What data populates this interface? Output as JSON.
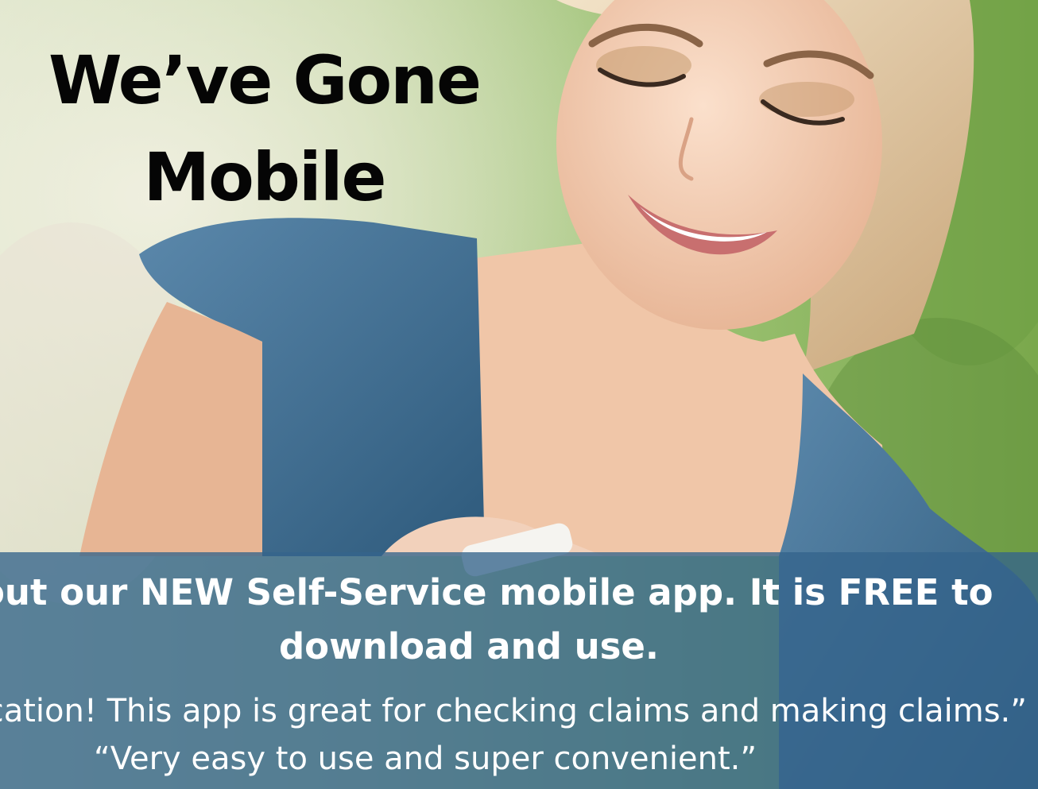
{
  "promo_slide": {
    "headline": [
      "We’ve Gone",
      "Mobile"
    ],
    "promo_text": [
      "out our NEW Self-Service mobile app. It is FREE to",
      "download and use."
    ],
    "testimonials": [
      "plication! This app is great for checking claims and making claims.”",
      "“Very easy to use and super convenient.”"
    ],
    "background_photo": "woman-smiling-at-phone",
    "colors": {
      "banner": "#34648c",
      "headline_text": "#050505",
      "banner_text": "#ffffff",
      "foliage": "#8bb865",
      "dress": "#3d6e93",
      "skin": "#f1c9ad"
    }
  }
}
